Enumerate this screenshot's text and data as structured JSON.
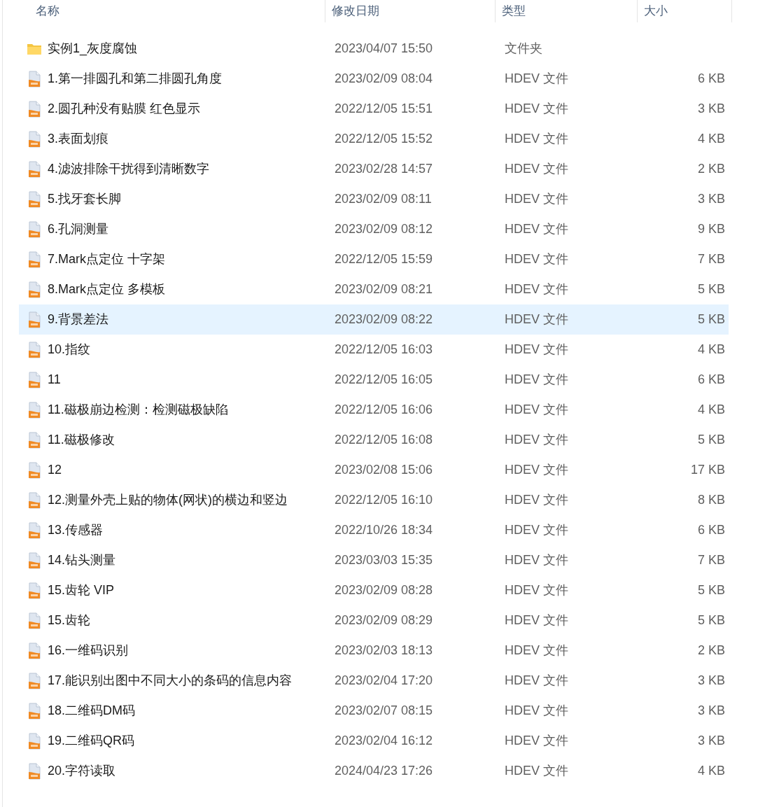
{
  "columns": [
    "名称",
    "修改日期",
    "类型",
    "大小"
  ],
  "rows": [
    {
      "kind": "folder",
      "name": "实例1_灰度腐蚀",
      "date": "2023/04/07 15:50",
      "type": "文件夹",
      "selected": false
    },
    {
      "kind": "file",
      "name": "1.第一排圆孔和第二排圆孔角度",
      "date": "2023/02/09 08:04",
      "type": "HDEV 文件",
      "size": "6 KB",
      "selected": false
    },
    {
      "kind": "file",
      "name": "2.圆孔种没有贴膜 红色显示",
      "date": "2022/12/05 15:51",
      "type": "HDEV 文件",
      "size": "3 KB",
      "selected": false
    },
    {
      "kind": "file",
      "name": "3.表面划痕",
      "date": "2022/12/05 15:52",
      "type": "HDEV 文件",
      "size": "4 KB",
      "selected": false
    },
    {
      "kind": "file",
      "name": "4.滤波排除干扰得到清晰数字",
      "date": "2023/02/28 14:57",
      "type": "HDEV 文件",
      "size": "2 KB",
      "selected": false
    },
    {
      "kind": "file",
      "name": "5.找牙套长脚",
      "date": "2023/02/09 08:11",
      "type": "HDEV 文件",
      "size": "3 KB",
      "selected": false
    },
    {
      "kind": "file",
      "name": "6.孔洞测量",
      "date": "2023/02/09 08:12",
      "type": "HDEV 文件",
      "size": "9 KB",
      "selected": false
    },
    {
      "kind": "file",
      "name": "7.Mark点定位 十字架",
      "date": "2022/12/05 15:59",
      "type": "HDEV 文件",
      "size": "7 KB",
      "selected": false
    },
    {
      "kind": "file",
      "name": "8.Mark点定位 多模板",
      "date": "2023/02/09 08:21",
      "type": "HDEV 文件",
      "size": "5 KB",
      "selected": false
    },
    {
      "kind": "file",
      "name": "9.背景差法",
      "date": "2023/02/09 08:22",
      "type": "HDEV 文件",
      "size": "5 KB",
      "selected": true
    },
    {
      "kind": "file",
      "name": "10.指纹",
      "date": "2022/12/05 16:03",
      "type": "HDEV 文件",
      "size": "4 KB",
      "selected": false
    },
    {
      "kind": "file",
      "name": "11",
      "date": "2022/12/05 16:05",
      "type": "HDEV 文件",
      "size": "6 KB",
      "selected": false
    },
    {
      "kind": "file",
      "name": "11.磁极崩边检测：检测磁极缺陷",
      "date": "2022/12/05 16:06",
      "type": "HDEV 文件",
      "size": "4 KB",
      "selected": false
    },
    {
      "kind": "file",
      "name": "11.磁极修改",
      "date": "2022/12/05 16:08",
      "type": "HDEV 文件",
      "size": "5 KB",
      "selected": false
    },
    {
      "kind": "file",
      "name": "12",
      "date": "2023/02/08 15:06",
      "type": "HDEV 文件",
      "size": "17 KB",
      "selected": false
    },
    {
      "kind": "file",
      "name": "12.测量外壳上贴的物体(网状)的横边和竖边",
      "date": "2022/12/05 16:10",
      "type": "HDEV 文件",
      "size": "8 KB",
      "selected": false
    },
    {
      "kind": "file",
      "name": "13.传感器",
      "date": "2022/10/26 18:34",
      "type": "HDEV 文件",
      "size": "6 KB",
      "selected": false
    },
    {
      "kind": "file",
      "name": "14.钻头测量",
      "date": "2023/03/03 15:35",
      "type": "HDEV 文件",
      "size": "7 KB",
      "selected": false
    },
    {
      "kind": "file",
      "name": "15.齿轮 VIP",
      "date": "2023/02/09 08:28",
      "type": "HDEV 文件",
      "size": "5 KB",
      "selected": false
    },
    {
      "kind": "file",
      "name": "15.齿轮",
      "date": "2023/02/09 08:29",
      "type": "HDEV 文件",
      "size": "5 KB",
      "selected": false
    },
    {
      "kind": "file",
      "name": "16.一维码识别",
      "date": "2023/02/03 18:13",
      "type": "HDEV 文件",
      "size": "2 KB",
      "selected": false
    },
    {
      "kind": "file",
      "name": "17.能识别出图中不同大小的条码的信息内容",
      "date": "2023/02/04 17:20",
      "type": "HDEV 文件",
      "size": "3 KB",
      "selected": false
    },
    {
      "kind": "file",
      "name": "18.二维码DM码",
      "date": "2023/02/07 08:15",
      "type": "HDEV 文件",
      "size": "3 KB",
      "selected": false
    },
    {
      "kind": "file",
      "name": "19.二维码QR码",
      "date": "2023/02/04 16:12",
      "type": "HDEV 文件",
      "size": "3 KB",
      "selected": false
    },
    {
      "kind": "file",
      "name": "20.字符读取",
      "date": "2024/04/23 17:26",
      "type": "HDEV 文件",
      "size": "4 KB",
      "selected": false
    }
  ]
}
